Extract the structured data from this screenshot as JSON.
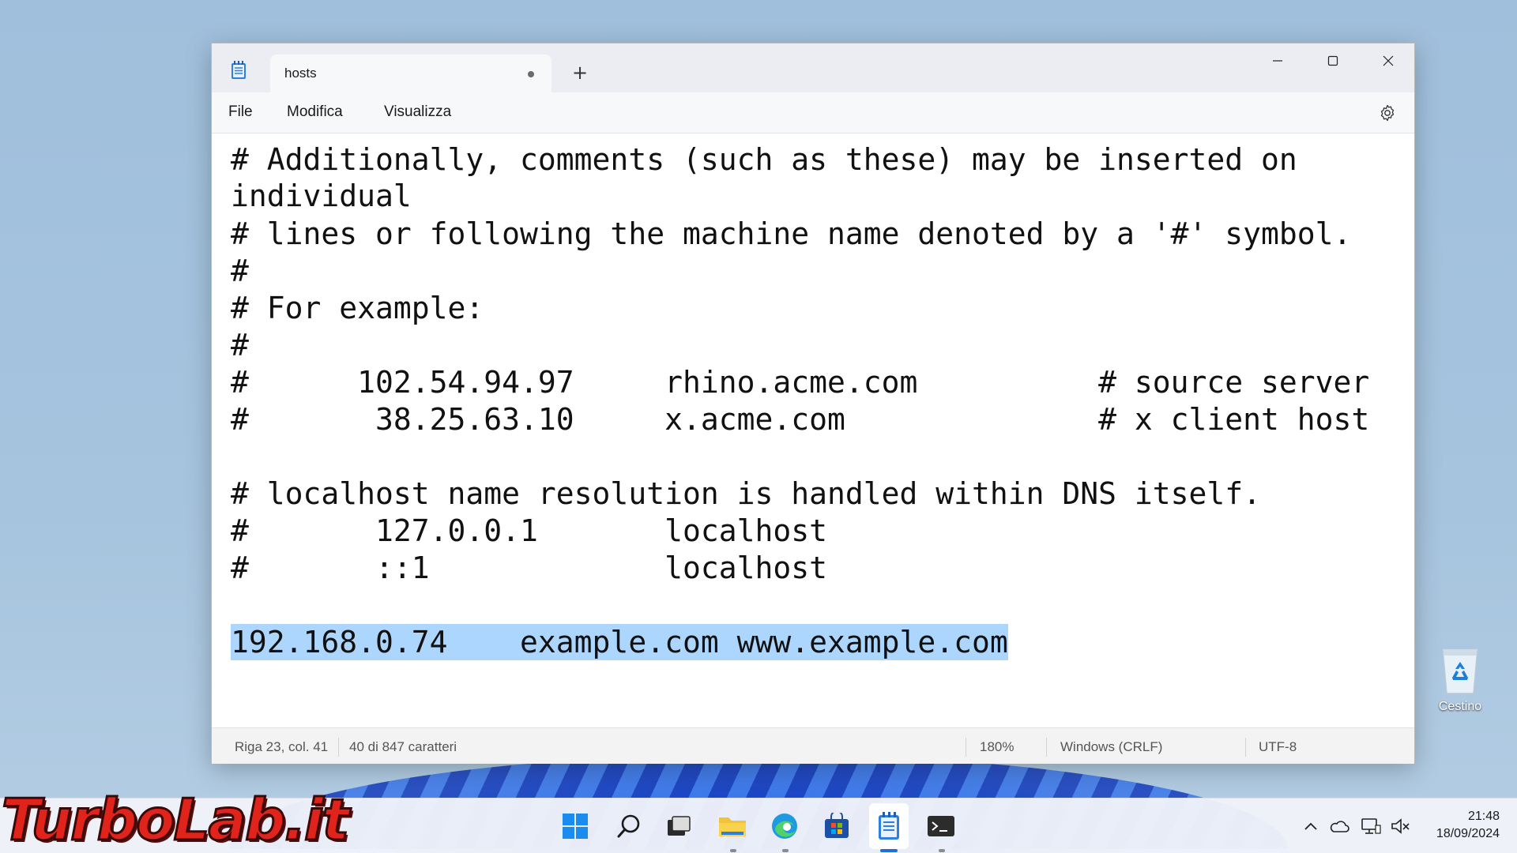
{
  "window": {
    "tab_title": "hosts",
    "new_tab_label": "+",
    "menu": [
      "File",
      "Modifica",
      "Visualizza"
    ]
  },
  "editor": {
    "lines": [
      "# Additionally, comments (such as these) may be inserted on",
      "individual",
      "# lines or following the machine name denoted by a '#' symbol.",
      "#",
      "# For example:",
      "#",
      "#      102.54.94.97     rhino.acme.com          # source server",
      "#       38.25.63.10     x.acme.com              # x client host",
      "",
      "# localhost name resolution is handled within DNS itself.",
      "#       127.0.0.1       localhost",
      "#       ::1             localhost",
      "",
      "192.168.0.74    example.com www.example.com"
    ]
  },
  "status": {
    "position": "Riga 23, col. 41",
    "chars": "40 di 847 caratteri",
    "zoom": "180%",
    "line_ending": "Windows (CRLF)",
    "encoding": "UTF-8"
  },
  "desktop": {
    "recycle_bin_label": "Cestino",
    "watermark": "TurboLab.it"
  },
  "taskbar": {
    "time": "21:48",
    "date": "18/09/2024"
  },
  "colors": {
    "selection": "#add6ff",
    "accent": "#1f6fd6"
  }
}
